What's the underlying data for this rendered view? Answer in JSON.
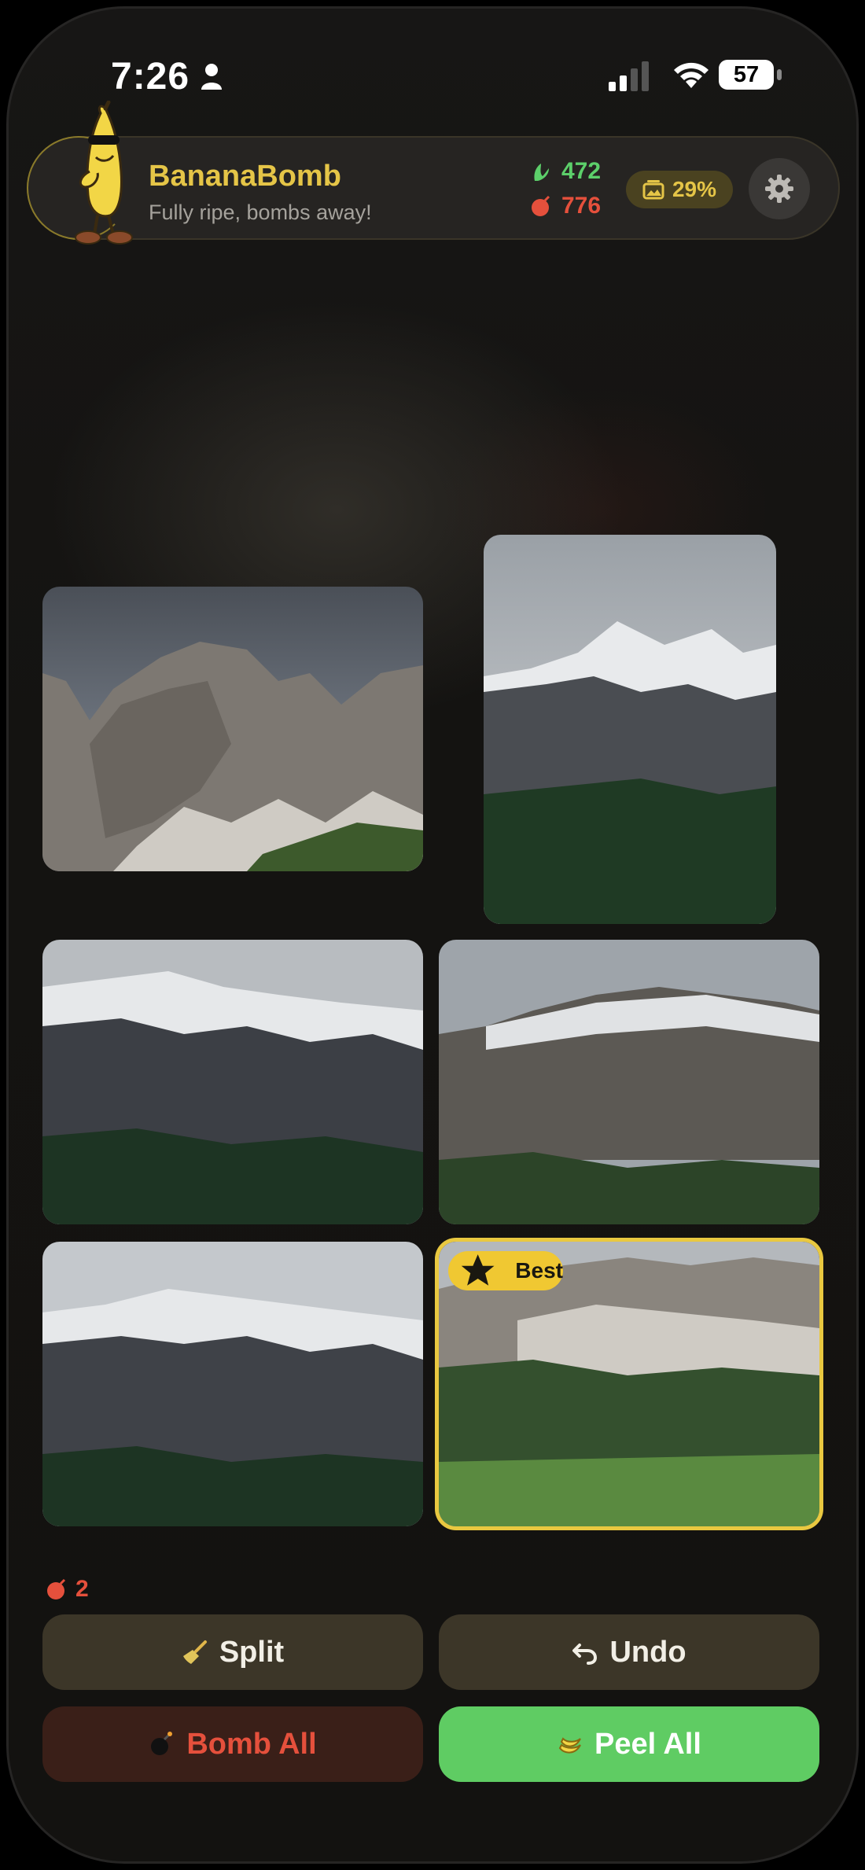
{
  "status_bar": {
    "time": "7:26",
    "battery": "57"
  },
  "header": {
    "title": "BananaBomb",
    "subtitle": "Fully ripe, bombs away!",
    "peel_count": "472",
    "bomb_count": "776",
    "progress_label": "29%",
    "progress_percent": 29,
    "settings_icon": "gear-icon",
    "accent_color": "#e5c547"
  },
  "photos": [
    {
      "name": "photo-1",
      "selected": false
    },
    {
      "name": "photo-2",
      "selected": false
    },
    {
      "name": "photo-3",
      "selected": false
    },
    {
      "name": "photo-4",
      "selected": false
    },
    {
      "name": "photo-5",
      "selected": false
    },
    {
      "name": "photo-6",
      "selected": true,
      "badge": "Best"
    }
  ],
  "pending_bombs": "2",
  "actions": {
    "split_label": "Split",
    "undo_label": "Undo",
    "bomb_all_label": "Bomb All",
    "peel_all_label": "Peel All"
  },
  "colors": {
    "peel_green": "#5fcc63",
    "bomb_red": "#e5503c",
    "best_yellow": "#f0c832"
  }
}
